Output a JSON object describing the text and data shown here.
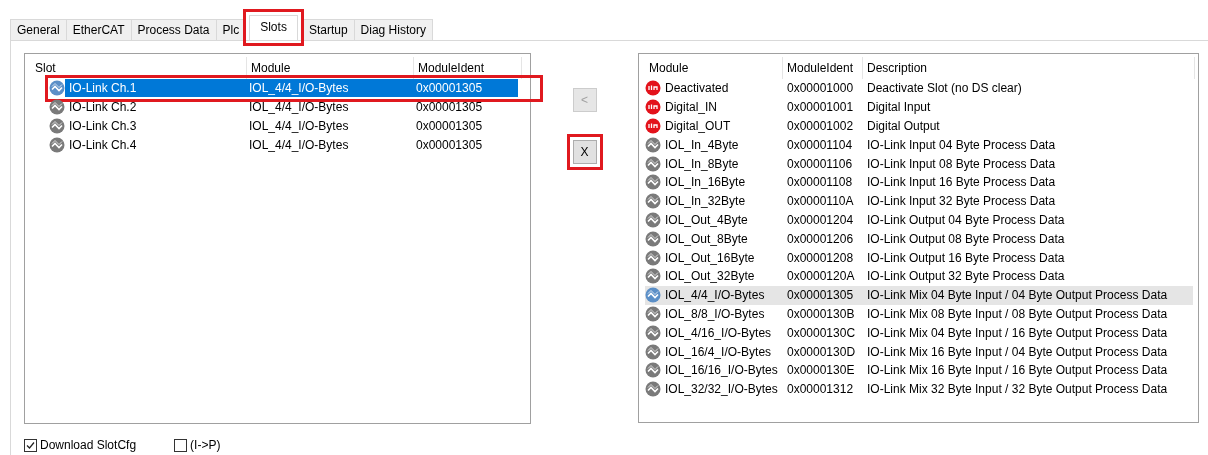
{
  "tabs": [
    {
      "label": "General",
      "selected": false,
      "highlighted": false
    },
    {
      "label": "EtherCAT",
      "selected": false,
      "highlighted": false
    },
    {
      "label": "Process Data",
      "selected": false,
      "highlighted": false
    },
    {
      "label": "Plc",
      "selected": false,
      "highlighted": false
    },
    {
      "label": "Slots",
      "selected": true,
      "highlighted": true
    },
    {
      "label": "Startup",
      "selected": false,
      "highlighted": false
    },
    {
      "label": "Diag History",
      "selected": false,
      "highlighted": false
    }
  ],
  "slots": {
    "columns": [
      "Slot",
      "Module",
      "ModuleIdent"
    ],
    "rows": [
      {
        "slot": "IO-Link Ch.1",
        "module": "IOL_4/4_I/O-Bytes",
        "ident": "0x00001305",
        "selected": true,
        "highlighted": true
      },
      {
        "slot": "IO-Link Ch.2",
        "module": "IOL_4/4_I/O-Bytes",
        "ident": "0x00001305",
        "selected": false,
        "highlighted": false
      },
      {
        "slot": "IO-Link Ch.3",
        "module": "IOL_4/4_I/O-Bytes",
        "ident": "0x00001305",
        "selected": false,
        "highlighted": false
      },
      {
        "slot": "IO-Link Ch.4",
        "module": "IOL_4/4_I/O-Bytes",
        "ident": "0x00001305",
        "selected": false,
        "highlighted": false
      }
    ]
  },
  "buttons": [
    {
      "label": "<",
      "disabled": true,
      "highlighted": false
    },
    {
      "label": "X",
      "disabled": false,
      "highlighted": true
    }
  ],
  "modules": {
    "columns": [
      "Module",
      "ModuleIdent",
      "Description"
    ],
    "rows": [
      {
        "kind": "vendor",
        "module": "Deactivated",
        "ident": "0x00001000",
        "description": "Deactivate Slot (no DS clear)",
        "selected": false
      },
      {
        "kind": "vendor",
        "module": "Digital_IN",
        "ident": "0x00001001",
        "description": "Digital Input",
        "selected": false
      },
      {
        "kind": "vendor",
        "module": "Digital_OUT",
        "ident": "0x00001002",
        "description": "Digital Output",
        "selected": false
      },
      {
        "kind": "iolink",
        "module": "IOL_In_4Byte",
        "ident": "0x00001104",
        "description": "IO-Link  Input 04 Byte Process Data",
        "selected": false
      },
      {
        "kind": "iolink",
        "module": "IOL_In_8Byte",
        "ident": "0x00001106",
        "description": "IO-Link  Input 08 Byte Process Data",
        "selected": false
      },
      {
        "kind": "iolink",
        "module": "IOL_In_16Byte",
        "ident": "0x00001108",
        "description": "IO-Link  Input 16 Byte Process Data",
        "selected": false
      },
      {
        "kind": "iolink",
        "module": "IOL_In_32Byte",
        "ident": "0x0000110A",
        "description": "IO-Link  Input 32 Byte Process Data",
        "selected": false
      },
      {
        "kind": "iolink",
        "module": "IOL_Out_4Byte",
        "ident": "0x00001204",
        "description": "IO-Link  Output 04 Byte Process Data",
        "selected": false
      },
      {
        "kind": "iolink",
        "module": "IOL_Out_8Byte",
        "ident": "0x00001206",
        "description": "IO-Link  Output 08 Byte Process Data",
        "selected": false
      },
      {
        "kind": "iolink",
        "module": "IOL_Out_16Byte",
        "ident": "0x00001208",
        "description": "IO-Link  Output 16 Byte Process Data",
        "selected": false
      },
      {
        "kind": "iolink",
        "module": "IOL_Out_32Byte",
        "ident": "0x0000120A",
        "description": "IO-Link  Output 32 Byte Process Data",
        "selected": false
      },
      {
        "kind": "iolink",
        "module": "IOL_4/4_I/O-Bytes",
        "ident": "0x00001305",
        "description": "IO-Link Mix 04 Byte Input / 04 Byte Output Process Data",
        "selected": true
      },
      {
        "kind": "iolink",
        "module": "IOL_8/8_I/O-Bytes",
        "ident": "0x0000130B",
        "description": "IO-Link Mix 08 Byte Input / 08 Byte Output Process Data",
        "selected": false
      },
      {
        "kind": "iolink",
        "module": "IOL_4/16_I/O-Bytes",
        "ident": "0x0000130C",
        "description": "IO-Link Mix 04 Byte Input / 16 Byte Output Process Data",
        "selected": false
      },
      {
        "kind": "iolink",
        "module": "IOL_16/4_I/O-Bytes",
        "ident": "0x0000130D",
        "description": "IO-Link Mix 16 Byte Input / 04 Byte Output Process Data",
        "selected": false
      },
      {
        "kind": "iolink",
        "module": "IOL_16/16_I/O-Bytes",
        "ident": "0x0000130E",
        "description": "IO-Link Mix 16 Byte Input / 16 Byte Output Process Data",
        "selected": false
      },
      {
        "kind": "iolink",
        "module": "IOL_32/32_I/O-Bytes",
        "ident": "0x00001312",
        "description": "IO-Link Mix 32 Byte Input / 32 Byte Output Process Data",
        "selected": false
      }
    ]
  },
  "checkboxes": [
    {
      "label": "Download SlotCfg",
      "checked": true
    },
    {
      "label": "(I->P)",
      "checked": false
    }
  ]
}
